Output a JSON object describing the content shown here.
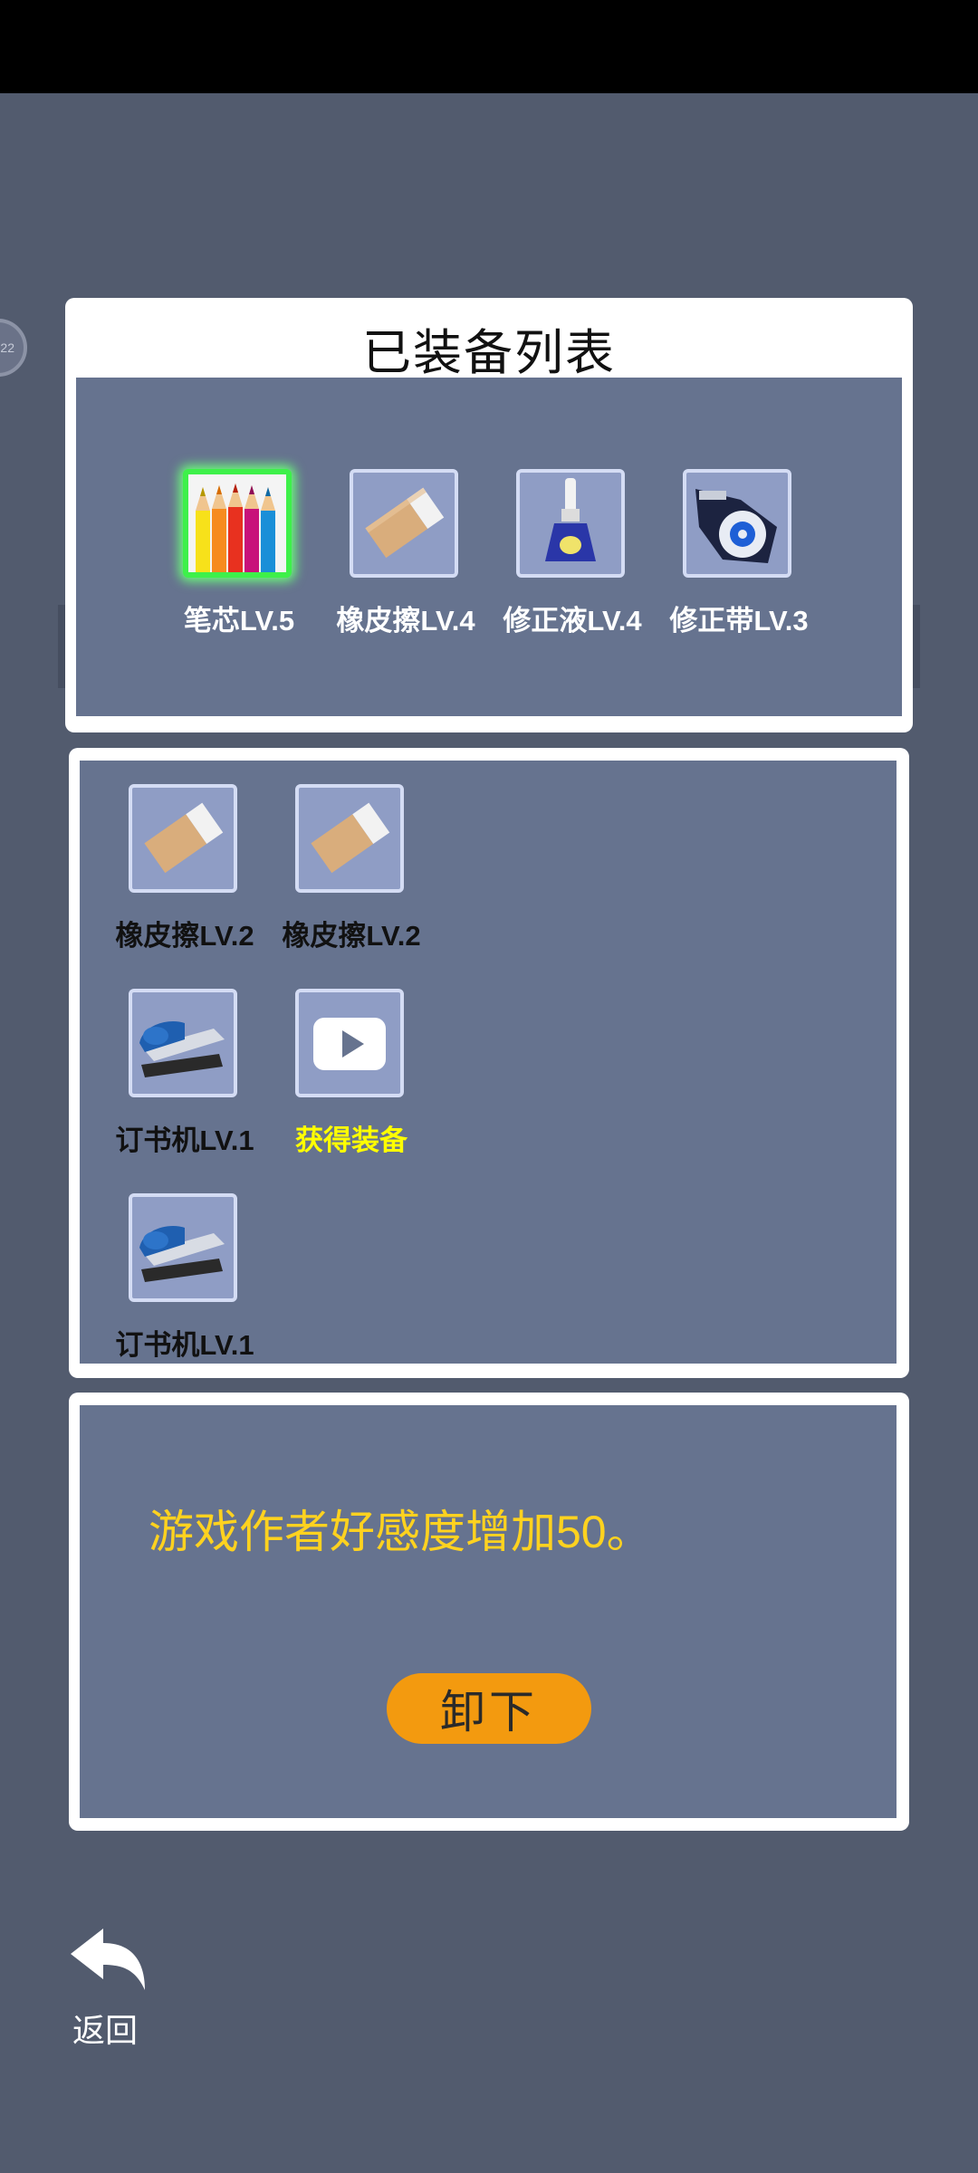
{
  "side_badge": "22",
  "equipped": {
    "title": "已装备列表",
    "items": [
      {
        "icon": "colored-pencils-icon",
        "label": "笔芯LV.5",
        "selected": true
      },
      {
        "icon": "eraser-icon",
        "label": "橡皮擦LV.4",
        "selected": false
      },
      {
        "icon": "correction-fluid-icon",
        "label": "修正液LV.4",
        "selected": false
      },
      {
        "icon": "correction-tape-icon",
        "label": "修正带LV.3",
        "selected": false
      }
    ]
  },
  "inventory": {
    "items": [
      {
        "icon": "eraser-icon",
        "label": "橡皮擦LV.2"
      },
      {
        "icon": "eraser-icon",
        "label": "橡皮擦LV.2"
      },
      {
        "icon": "stapler-icon",
        "label": "订书机LV.1"
      },
      {
        "icon": "video-play-icon",
        "label": "获得装备"
      },
      {
        "icon": "stapler-icon",
        "label": "订书机LV.1"
      }
    ]
  },
  "detail": {
    "description": "游戏作者好感度增加50。",
    "button_label": "卸下"
  },
  "back": {
    "icon": "back-arrow-icon",
    "label": "返回"
  },
  "colors": {
    "background": "#525b6e",
    "panel_fill": "#66738f",
    "selected_glow": "#3ef04a",
    "description_text": "#ffd21f",
    "button": "#f39a0f",
    "get_equipment_text": "#ffff00"
  }
}
